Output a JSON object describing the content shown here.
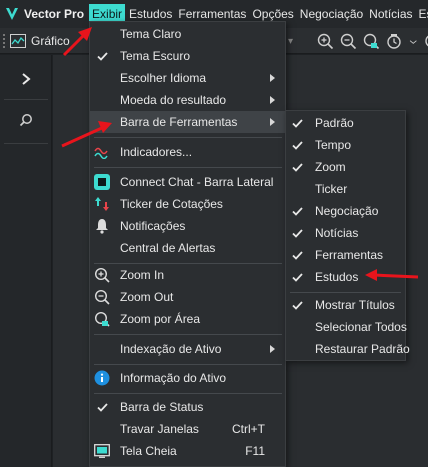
{
  "app": {
    "name": "Vector Pro"
  },
  "menubar": {
    "items": [
      "Exibir",
      "Estudos",
      "Ferramentas",
      "Opções",
      "Negociação",
      "Notícias",
      "Estra"
    ]
  },
  "toolbar": {
    "grafico_label": "Gráfico"
  },
  "menu": {
    "items": [
      {
        "label": "Tema Claro",
        "checked": false
      },
      {
        "label": "Tema Escuro",
        "checked": true
      },
      {
        "label": "Escolher Idioma",
        "submenu": true
      },
      {
        "label": "Moeda do resultado",
        "submenu": true
      },
      {
        "label": "Barra de Ferramentas",
        "submenu": true,
        "highlighted": true
      },
      {
        "label": "Indicadores...",
        "icon": "indicators-icon"
      },
      {
        "label": "Connect Chat - Barra Lateral",
        "icon": "chat-icon"
      },
      {
        "label": "Ticker de Cotações",
        "icon": "ticker-icon"
      },
      {
        "label": "Notificações",
        "icon": "bell-icon"
      },
      {
        "label": "Central de Alertas"
      },
      {
        "label": "Zoom In",
        "icon": "zoom-in-icon"
      },
      {
        "label": "Zoom Out",
        "icon": "zoom-out-icon"
      },
      {
        "label": "Zoom por Área",
        "icon": "zoom-area-icon"
      },
      {
        "label": "Indexação de Ativo",
        "submenu": true
      },
      {
        "label": "Informação do Ativo",
        "icon": "info-icon"
      },
      {
        "label": "Barra de Status",
        "checked": true
      },
      {
        "label": "Travar Janelas",
        "shortcut": "Ctrl+T"
      },
      {
        "label": "Tela Cheia",
        "shortcut": "F11",
        "icon": "fullscreen-icon"
      }
    ]
  },
  "submenu": {
    "items": [
      {
        "label": "Padrão",
        "checked": true
      },
      {
        "label": "Tempo",
        "checked": true
      },
      {
        "label": "Zoom",
        "checked": true
      },
      {
        "label": "Ticker",
        "checked": false
      },
      {
        "label": "Negociação",
        "checked": true
      },
      {
        "label": "Notícias",
        "checked": true
      },
      {
        "label": "Ferramentas",
        "checked": true
      },
      {
        "label": "Estudos",
        "checked": true
      },
      {
        "label": "Mostrar Títulos",
        "checked": true
      },
      {
        "label": "Selecionar Todos",
        "checked": false
      },
      {
        "label": "Restaurar Padrão",
        "checked": false
      }
    ]
  },
  "colors": {
    "accent": "#3ddbd0",
    "annotation": "#e8141c",
    "background": "#1e2124",
    "menu_bg": "#2b2e31"
  }
}
